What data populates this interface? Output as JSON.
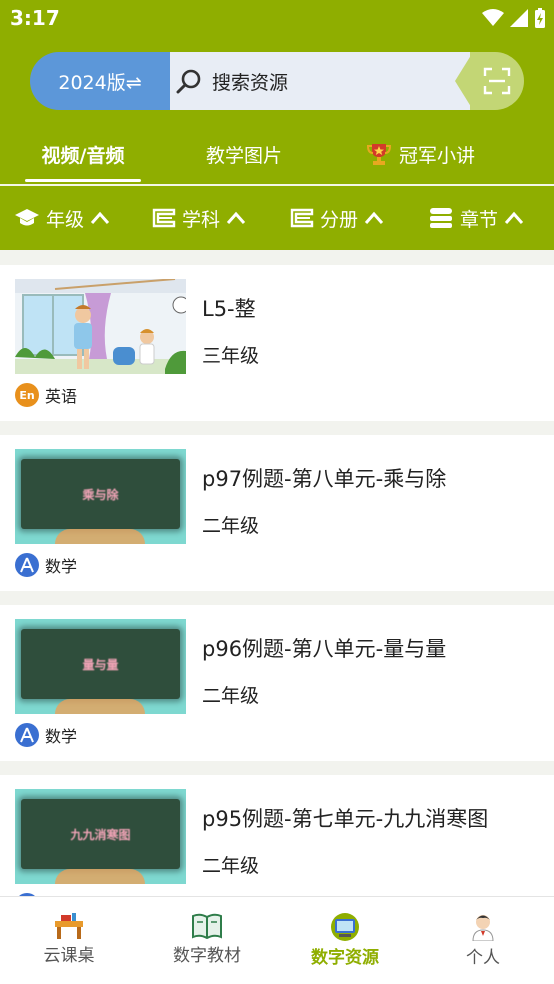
{
  "status_bar": {
    "time": "3:17",
    "icons": [
      "wifi-icon",
      "signal-icon",
      "battery-charging-icon"
    ]
  },
  "header": {
    "version_label": "2024版⇌",
    "search_placeholder": "搜索资源",
    "scan_icon": "scan-icon"
  },
  "tabs": [
    {
      "label": "视频/音频",
      "active": true
    },
    {
      "label": "教学图片",
      "active": false
    },
    {
      "label": "冠军小讲",
      "active": false,
      "icon": "trophy-icon"
    }
  ],
  "filters": [
    {
      "label": "年级",
      "icon": "graduation-cap-icon"
    },
    {
      "label": "学科",
      "icon": "book-icon"
    },
    {
      "label": "分册",
      "icon": "book-icon"
    },
    {
      "label": "章节",
      "icon": "stack-icon"
    }
  ],
  "items": [
    {
      "title": "L5-整",
      "grade": "三年级",
      "subject": "英语",
      "subject_icon": "english-icon",
      "subject_icon_text": "En",
      "subject_color": "#e8901c",
      "thumb": "classroom-illustration",
      "board_text": ""
    },
    {
      "title": "p97例题-第八单元-乘与除",
      "grade": "二年级",
      "subject": "数学",
      "subject_icon": "math-compass-icon",
      "subject_icon_text": "",
      "subject_color": "#3a6fd1",
      "thumb": "chalkboard",
      "board_text": "乘与除"
    },
    {
      "title": "p96例题-第八单元-量与量",
      "grade": "二年级",
      "subject": "数学",
      "subject_icon": "math-compass-icon",
      "subject_icon_text": "",
      "subject_color": "#3a6fd1",
      "thumb": "chalkboard",
      "board_text": "量与量"
    },
    {
      "title": "p95例题-第七单元-九九消寒图",
      "grade": "二年级",
      "subject": "数学",
      "subject_icon": "math-compass-icon",
      "subject_icon_text": "",
      "subject_color": "#3a6fd1",
      "thumb": "chalkboard",
      "board_text": "九九消寒图"
    }
  ],
  "bottom_nav": [
    {
      "label": "云课桌",
      "icon": "desk-icon",
      "active": false
    },
    {
      "label": "数字教材",
      "icon": "textbook-icon",
      "active": false
    },
    {
      "label": "数字资源",
      "icon": "computer-icon",
      "active": true
    },
    {
      "label": "个人",
      "icon": "person-icon",
      "active": false
    }
  ],
  "colors": {
    "brand": "#8fae00",
    "version_bg": "#5c97d9",
    "search_bg": "#e8edf5",
    "active_nav": "#8fae00"
  }
}
